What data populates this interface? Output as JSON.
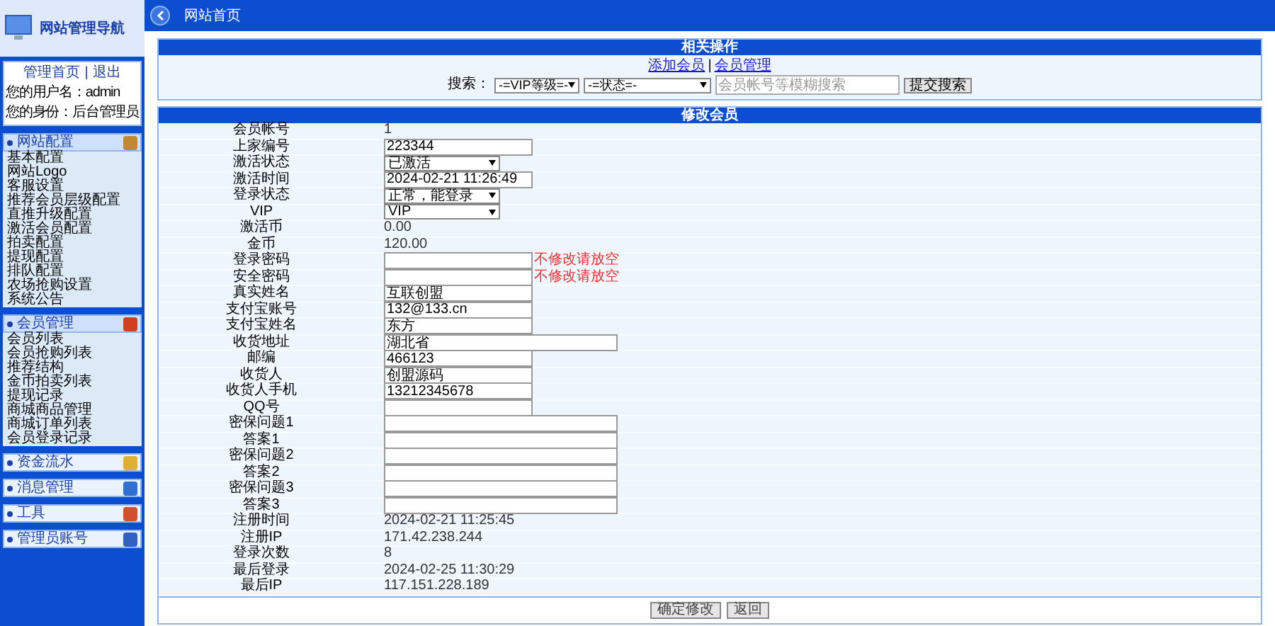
{
  "sidebar": {
    "logo_title": "网站管理导航",
    "top_links": [
      "管理首页",
      "退出"
    ],
    "separator": "|",
    "user_lines": [
      {
        "label": "您的用户名：",
        "value": "admin"
      },
      {
        "label": "您的身份：",
        "value": "后台管理员"
      }
    ],
    "groups": [
      {
        "title": "网站配置",
        "expanded": true,
        "items": [
          "基本配置",
          "网站Logo",
          "客服设置",
          "推荐会员层级配置",
          "直推升级配置",
          "激活会员配置",
          "拍卖配置",
          "提现配置",
          "排队配置",
          "农场抢购设置",
          "系统公告"
        ]
      },
      {
        "title": "会员管理",
        "expanded": true,
        "items": [
          "会员列表",
          "会员抢购列表",
          "推荐结构",
          "金币拍卖列表",
          "提现记录",
          "商城商品管理",
          "商城订单列表",
          "会员登录记录"
        ]
      },
      {
        "title": "资金流水",
        "expanded": false
      },
      {
        "title": "消息管理",
        "expanded": false
      },
      {
        "title": "工具",
        "expanded": false
      },
      {
        "title": "管理员账号",
        "expanded": false
      }
    ]
  },
  "header": {
    "title": "网站首页"
  },
  "actions_panel": {
    "title": "相关操作",
    "links": [
      "添加会员",
      "会员管理"
    ],
    "separator": "|",
    "search_label": "搜索：",
    "selects": [
      "-=VIP等级=-",
      "-=状态=-"
    ],
    "search_placeholder": "会员帐号等模糊搜索",
    "search_button": "提交搜索"
  },
  "edit_panel": {
    "title": "修改会员",
    "rows": [
      {
        "label": "会员帐号",
        "kind": "text",
        "value": "1"
      },
      {
        "label": "上家编号",
        "kind": "input",
        "value": "223344"
      },
      {
        "label": "激活状态",
        "kind": "select",
        "value": "已激活"
      },
      {
        "label": "激活时间",
        "kind": "input",
        "value": "2024-02-21 11:26:49"
      },
      {
        "label": "登录状态",
        "kind": "select",
        "value": "正常，能登录"
      },
      {
        "label": "VIP",
        "kind": "select",
        "value": "VIP"
      },
      {
        "label": "激活币",
        "kind": "text",
        "value": "0.00"
      },
      {
        "label": "金币",
        "kind": "text",
        "value": "120.00"
      },
      {
        "label": "登录密码",
        "kind": "input",
        "value": "",
        "note": "不修改请放空"
      },
      {
        "label": "安全密码",
        "kind": "input",
        "value": "",
        "note": "不修改请放空"
      },
      {
        "label": "真实姓名",
        "kind": "input",
        "value": "互联创盟"
      },
      {
        "label": "支付宝账号",
        "kind": "input",
        "value": "132@133.cn"
      },
      {
        "label": "支付宝姓名",
        "kind": "input",
        "value": "东方"
      },
      {
        "label": "收货地址",
        "kind": "wide",
        "value": "湖北省"
      },
      {
        "label": "邮编",
        "kind": "input",
        "value": "466123"
      },
      {
        "label": "收货人",
        "kind": "input",
        "value": "创盟源码"
      },
      {
        "label": "收货人手机",
        "kind": "input",
        "value": "13212345678"
      },
      {
        "label": "QQ号",
        "kind": "input",
        "value": ""
      },
      {
        "label": "密保问题1",
        "kind": "wide",
        "value": ""
      },
      {
        "label": "答案1",
        "kind": "wide",
        "value": ""
      },
      {
        "label": "密保问题2",
        "kind": "wide",
        "value": ""
      },
      {
        "label": "答案2",
        "kind": "wide",
        "value": ""
      },
      {
        "label": "密保问题3",
        "kind": "wide",
        "value": ""
      },
      {
        "label": "答案3",
        "kind": "wide",
        "value": ""
      },
      {
        "label": "注册时间",
        "kind": "text",
        "value": "2024-02-21 11:25:45"
      },
      {
        "label": "注册IP",
        "kind": "text",
        "value": "171.42.238.244"
      },
      {
        "label": "登录次数",
        "kind": "text",
        "value": "8"
      },
      {
        "label": "最后登录",
        "kind": "text",
        "value": "2024-02-25 11:30:29"
      },
      {
        "label": "最后IP",
        "kind": "text",
        "value": "117.151.228.189"
      }
    ],
    "buttons": [
      "确定修改",
      "返回"
    ]
  }
}
